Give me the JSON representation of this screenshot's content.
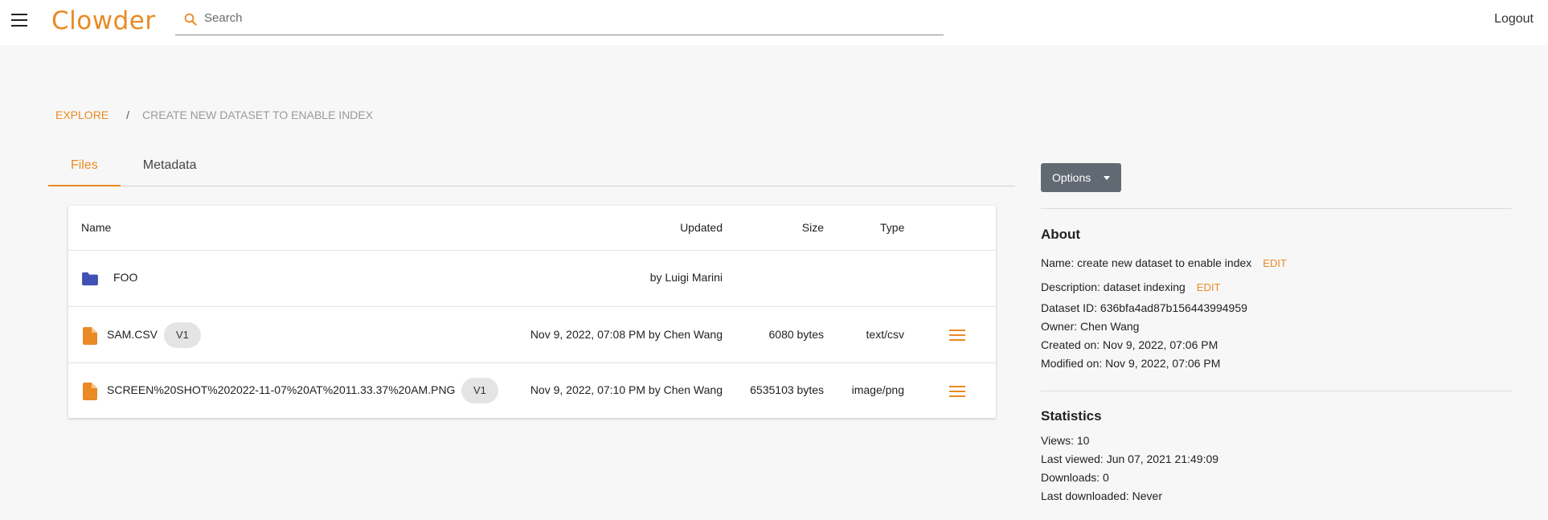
{
  "header": {
    "logo_text": "Clowder",
    "search_placeholder": "Search",
    "logout_label": "Logout"
  },
  "breadcrumb": {
    "root": "Explore",
    "separator": "/",
    "current": "create new dataset to enable index"
  },
  "tabs": [
    {
      "label": "Files"
    },
    {
      "label": "Metadata"
    }
  ],
  "table": {
    "columns": [
      "Name",
      "Updated",
      "Size",
      "Type"
    ],
    "rows": [
      {
        "name": "FOO",
        "updated": "by Luigi Marini",
        "size": "",
        "type": "",
        "version": ""
      },
      {
        "name": "SAM.CSV",
        "updated": "Nov 9, 2022, 07:08 PM by Chen Wang",
        "size": "6080 bytes",
        "type": "text/csv",
        "version": "V1"
      },
      {
        "name": "SCREEN%20SHOT%202022-11-07%20AT%2011.33.37%20AM.PNG",
        "updated": "Nov 9, 2022, 07:10 PM by Chen Wang",
        "size": "6535103 bytes",
        "type": "image/png",
        "version": "V1"
      }
    ]
  },
  "sidebar": {
    "options_label": "Options",
    "about_heading": "About",
    "name_line": "Name: create new dataset to enable index",
    "description_line": "Description: dataset indexing",
    "edit_label": "EDIT",
    "dataset_id_line": "Dataset ID: 636bfa4ad87b156443994959",
    "owner_line": "Owner: Chen Wang",
    "created_line": "Created on: Nov 9, 2022, 07:06 PM",
    "modified_line": "Modified on: Nov 9, 2022, 07:06 PM",
    "statistics_heading": "Statistics",
    "views_line": "Views: 10",
    "last_viewed_line": "Last viewed: Jun 07, 2021 21:49:09",
    "downloads_line": "Downloads: 0",
    "last_downloaded_line": "Last downloaded: Never"
  },
  "colors": {
    "accent": "#e98a24",
    "folder": "#3f51b5",
    "options_button": "#616a73"
  }
}
